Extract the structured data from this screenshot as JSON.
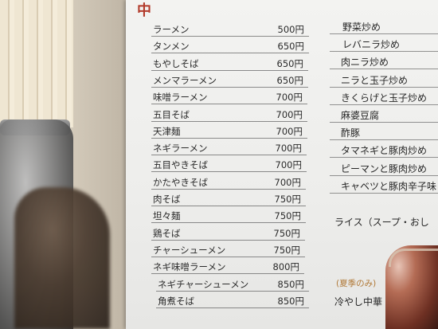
{
  "menu_left": [
    {
      "name": "ラーメン",
      "price": "500円"
    },
    {
      "name": "タンメン",
      "price": "650円"
    },
    {
      "name": "もやしそば",
      "price": "650円"
    },
    {
      "name": "メンマラーメン",
      "price": "650円"
    },
    {
      "name": "味噌ラーメン",
      "price": "700円"
    },
    {
      "name": "五目そば",
      "price": "700円"
    },
    {
      "name": "天津麺",
      "price": "700円"
    },
    {
      "name": "ネギラーメン",
      "price": "700円"
    },
    {
      "name": "五目やきそば",
      "price": "700円"
    },
    {
      "name": "かたやきそば",
      "price": "700円"
    },
    {
      "name": "肉そば",
      "price": "750円"
    },
    {
      "name": "坦々麺",
      "price": "750円"
    },
    {
      "name": "鶏そば",
      "price": "750円"
    },
    {
      "name": "チャーシューメン",
      "price": "750円"
    },
    {
      "name": "ネギ味噌ラーメン",
      "price": "800円"
    },
    {
      "name": "ネギチャーシューメン",
      "price": "850円"
    },
    {
      "name": "角煮そば",
      "price": "850円"
    }
  ],
  "menu_right": [
    "野菜炒め",
    "レバニラ炒め",
    "肉ニラ炒め",
    "ニラと玉子炒め",
    "きくらげと玉子炒め",
    "麻婆豆腐",
    "酢豚",
    "タマネギと豚肉炒め",
    "ピーマンと豚肉炒め",
    "キャベツと豚肉辛子味"
  ],
  "rice_line": "ライス（スープ・おし",
  "seasonal_note": "(夏季のみ)",
  "bottom_item": "冷やし中華"
}
